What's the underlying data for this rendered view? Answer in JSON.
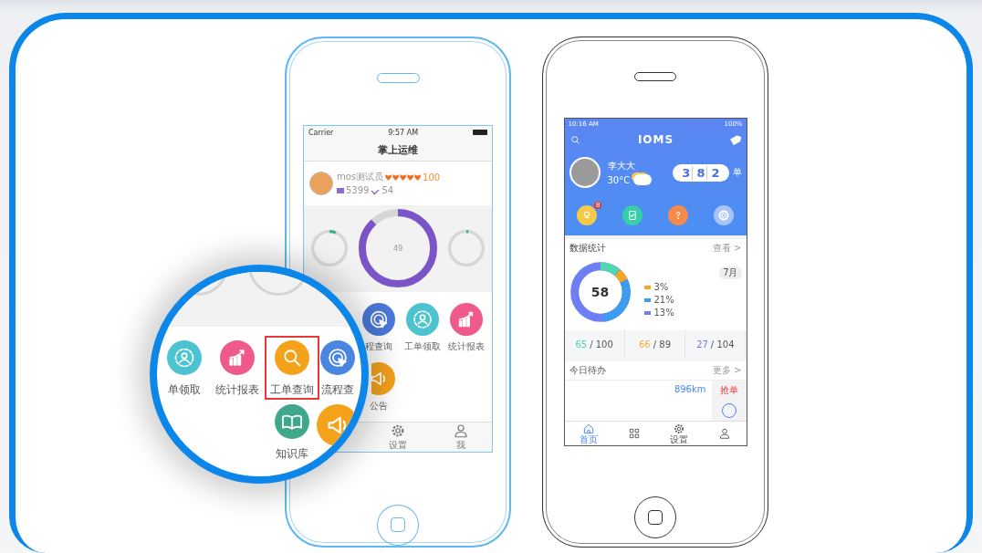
{
  "left_phone": {
    "status_bar": {
      "carrier": "Carrier",
      "time": "9:57 AM"
    },
    "title": "掌上运维",
    "user": {
      "name": "mos测试员",
      "stars": 5,
      "score": "100",
      "messages": "5399",
      "checks": "54"
    },
    "gauges": [
      {
        "level": 0.06
      },
      {
        "value": "49",
        "level": 0.88
      },
      {
        "level": 0.02
      }
    ],
    "menu": [
      {
        "kind": "target",
        "label": "程查询",
        "color": "#4a78d8"
      },
      {
        "kind": "people",
        "label": "工单领取",
        "color": "#4cc3d0"
      },
      {
        "kind": "chart",
        "label": "统计报表",
        "color": "#f05a8a"
      },
      {
        "kind": "speaker",
        "label": "公告",
        "color": "#f5a21b"
      }
    ],
    "tabs": [
      {
        "kind": "gear",
        "label": "设置"
      },
      {
        "kind": "person",
        "label": "我"
      }
    ]
  },
  "magnifier": {
    "items": [
      {
        "kind": "people",
        "label": "单领取",
        "color": "#4cc3d0",
        "selected": false
      },
      {
        "kind": "chart",
        "label": "统计报表",
        "color": "#f05a8a",
        "selected": false
      },
      {
        "kind": "search",
        "label": "工单查询",
        "color": "#f5a21b",
        "selected": true
      },
      {
        "kind": "target",
        "label": "流程查",
        "color": "#4a86e0",
        "selected": false
      },
      {
        "kind": "book",
        "label": "知识库",
        "color": "#3fa88c",
        "selected": false
      },
      {
        "kind": "speaker",
        "color": "#f5a21b",
        "selected": false
      }
    ]
  },
  "right_phone": {
    "status_bar": {
      "time": "10:16 AM",
      "battery": "100%"
    },
    "logo": "IOMS",
    "user": {
      "name": "李大大",
      "temperature": "30°C"
    },
    "counter": {
      "digits": [
        "3",
        "8",
        "2"
      ],
      "unit": "单"
    },
    "shortcuts": [
      {
        "kind": "bulb",
        "color": "#f7c948",
        "badge": "8"
      },
      {
        "kind": "clipboard",
        "color": "#35d0a8"
      },
      {
        "kind": "question",
        "color": "#f58a4a"
      },
      {
        "kind": "gear",
        "color": "#a9c4fa"
      }
    ],
    "stats": {
      "title": "数据统计",
      "link": "查看 >",
      "month": "7月",
      "total": "58",
      "legend": [
        {
          "value": "3%",
          "color": "#f5a623"
        },
        {
          "value": "21%",
          "color": "#3d9bf2"
        },
        {
          "value": "13%",
          "color": "#6e7ff3"
        }
      ],
      "summary": [
        {
          "value": "65",
          "total": "/ 100",
          "color": "#4fcfb0"
        },
        {
          "value": "66",
          "total": "/ 89",
          "color": "#f2b134"
        },
        {
          "value": "27",
          "total": "/ 104",
          "color": "#7a72ef"
        }
      ]
    },
    "todo": {
      "title": "今日待办",
      "more": "更多 >",
      "distance": "896km",
      "action": "抢单"
    },
    "tabs": [
      {
        "kind": "home",
        "label": "首页",
        "selected": true
      },
      {
        "kind": "grid",
        "selected": false
      },
      {
        "kind": "gear",
        "label": "设置",
        "selected": false
      },
      {
        "kind": "person",
        "selected": false
      }
    ]
  }
}
